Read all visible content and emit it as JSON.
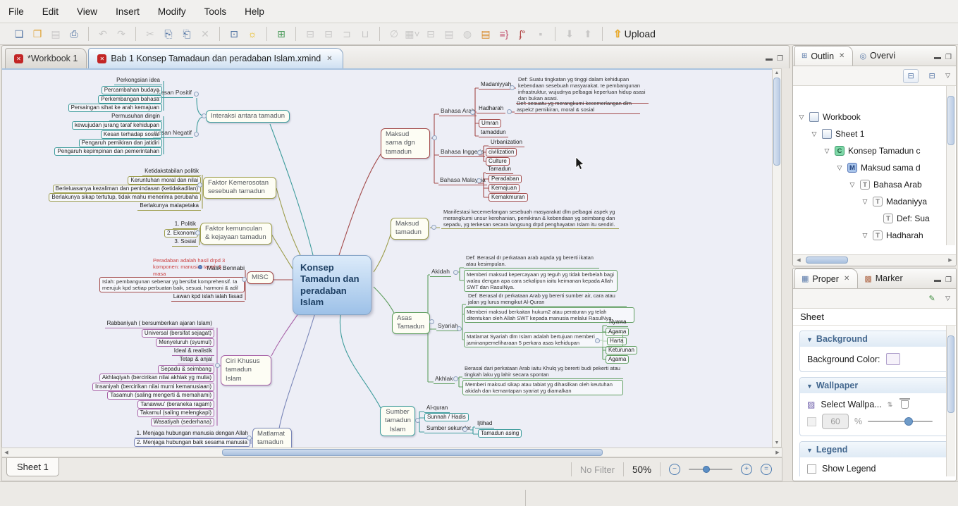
{
  "menu": {
    "items": [
      "File",
      "Edit",
      "View",
      "Insert",
      "Modify",
      "Tools",
      "Help"
    ]
  },
  "toolbar": {
    "upload_label": "Upload"
  },
  "editor_tabs": [
    {
      "label": "*Workbook 1"
    },
    {
      "label": "Bab 1 Konsep Tamadaun dan peradaban Islam.xmind"
    }
  ],
  "mindmap": {
    "colors": {
      "interaksi": "#3e9c9c",
      "faktor": "#9c9c4a",
      "misc": "#a34a4a",
      "ciri": "#a863a8",
      "matlamat": "#7a86b8",
      "sumber": "#3e9c9c",
      "asas": "#5f9e5f",
      "maksud": "#9c9c4a",
      "maksud_sama": "#a34a4a",
      "center_fill": "#aecdee"
    },
    "center": "Konsep Tamadun dan peradaban Islam",
    "maksud_sama": {
      "label": "Maksud sama dgn tamadun",
      "arab": {
        "label": "Bahasa Arab",
        "madaniyyah": "Madaniyyah",
        "madaniyyah_def": "Def: Suatu tingkatan yg tinggi dalam kehidupan kebendaan sesebuah masyarakat. Ie pembangunan infrastruktur, wujudnya pelbagai keperluan hidup asasi dan bukan asasi.",
        "hadharah": "Hadharah",
        "hadharah_def": "Def: sesuatu yg merangkumi kecemerlangan dlm aspek2 pemikiran, moral & sosial",
        "umran": "Umran",
        "tamaddun": "tamaddun"
      },
      "inggeris": {
        "label": "Bahasa Inggeris",
        "items": [
          "Urbanization",
          "civilization",
          "Culture"
        ]
      },
      "malaysia": {
        "label": "Bahasa Malaysia",
        "items": [
          "Tamadun",
          "Peradaban",
          "Kemajuan",
          "Kemakmuran"
        ]
      }
    },
    "maksud": {
      "label": "Maksud tamadun",
      "def": "Manifestasi kecemerlangan sesebuah masyarakat dlm pelbagai aspek yg merangkumi unsur kerohanian, pemikiran & kebendaan yg seimbang dan sepadu, yg terkesan secara langsung drpd penghayatan Islam itu sendiri."
    },
    "asas": {
      "label": "Asas Tamadun",
      "akidah": {
        "label": "Akidah",
        "def": "Def: Berasal dr perkataan arab aqada yg bererti ikatan atau kesimpulan.",
        "maksud": "Memberi maksud kepercayaan yg teguh yg tidak berbelah bagi walau dengan apa cara sekalipun iaitu keimanan kepada Allah SWT dan RasulNya."
      },
      "syariah": {
        "label": "Syariah",
        "def": "Def: Berasal dr perkataan Arab yg bererti sumber air, cara atau jalan yg lurus mengikut Al-Quran",
        "maksud": "Memberi maksud berkaitan hukum2 atau peraturan yg telah ditentukan oleh Allah SWT kepada manusia melalui RasulNya.",
        "matlamat": "Matlamat Syariah dlm Islam adalah bertujuan memberi jaminanpemeliharaan 5 perkara asas kehidupan",
        "perkara": [
          "Nyawa",
          "Agama",
          "Harta",
          "Keturunan",
          "Agama"
        ]
      },
      "akhlak": {
        "label": "Akhlak",
        "def": "Berasal dari perkataan Arab iaitu Khulq yg bererti budi pekerti atau tingkah laku yg lahir secara spontan",
        "maksud": "Memberi maksud sikap atau tabiat yg dihasilkan oleh keutuhan akidah dan kemantapan syariat yg diamalkan"
      }
    },
    "sumber": {
      "label": "Sumber tamadun Islam",
      "items": [
        "Al-quran",
        "Sunnah / Hadis",
        "Sumber sekunder"
      ],
      "sekunder": [
        "Ijtihad",
        "Tamadun asing"
      ]
    },
    "matlamat": {
      "label": "Matlamat tamadun",
      "items": [
        "1. Menjaga hubungan manusia dengan Allah",
        "2. Menjaga hubungan baik sesama manusia"
      ]
    },
    "ciri": {
      "label": "Ciri Khusus tamadun Islam",
      "items": [
        "Rabbaniyah ( bersumberkan ajaran Islam)",
        "Universal (bersifat sejagat)",
        "Menyeluruh (syumul)",
        "Ideal & realistik",
        "Tetap & anjal",
        "Sepadu & seimbang",
        "Akhlaqiyah (bercirikan nilai akhlak yg mulia)",
        "Insaniyah (bercirikan nilai murni kemanusiaan)",
        "Tasamuh (saling mengerti & memahami)",
        "Tanawwu' (beraneka ragam)",
        "Takamul (saling melengkapi)",
        "Wasatiyah (sederhana)"
      ]
    },
    "misc": {
      "label": "MISC",
      "note": "Peradaban adalah hasil drpd 3 komponen: manusia, tanah & masa",
      "bennabi": "Malik Bennabi",
      "islah": "Islah: pembangunan sebenar yg bersifat komprehensif. Ia merujuk kpd setiap perbuatan baik, sesuai, harmoni & adil",
      "lawan": "Lawan kpd islah ialah fasad"
    },
    "kemunculan": {
      "label": "Faktor kemunculan & kejayaan tamadun",
      "items": [
        "1. Politik",
        "2. Ekonomi",
        "3. Sosial"
      ]
    },
    "kemerosotan": {
      "label": "Faktor Kemerosotan sesebuah tamadun",
      "items": [
        "Ketidakstabilan politik",
        "Keruntuhan moral dan nilai",
        "Berleluasanya kezaliman dan penindasan (ketidakadilan)",
        "Berlakunya sikap tertutup, tidak mahu menerima perubaha",
        "Berlakunya malapetaka"
      ]
    },
    "interaksi": {
      "label": "Interaksi antara tamadun",
      "positif": {
        "label": "Kesan Positif",
        "items": [
          "Perkongsian idea",
          "Percambahan budaya",
          "Perkembangan bahasa",
          "Persaingan sihat ke arah kemajuan"
        ]
      },
      "negatif": {
        "label": "Kesan Negatif",
        "items": [
          "Permusuhan dingin",
          "kewujudan jurang taraf kehidupan",
          "Kesan terhadap sosial",
          "Pengaruh pemikiran dan jatidiri",
          "Pengaruh kepimpinan dan pemerintahan"
        ]
      }
    }
  },
  "outline": {
    "tab_outline": "Outlin",
    "tab_overview": "Overvi",
    "tree": [
      {
        "label": "Workbook"
      },
      {
        "label": "Sheet 1"
      },
      {
        "label": "Konsep Tamadun c"
      },
      {
        "label": "Maksud sama d"
      },
      {
        "label": "Bahasa Arab"
      },
      {
        "label": "Madaniyya"
      },
      {
        "label": "Def: Sua"
      },
      {
        "label": "Hadharah"
      }
    ]
  },
  "properties": {
    "tab_properties": "Proper",
    "tab_marker": "Marker",
    "sheet_label": "Sheet",
    "background": {
      "title": "Background",
      "color_label": "Background Color:"
    },
    "wallpaper": {
      "title": "Wallpaper",
      "select_label": "Select Wallpa...",
      "opacity_value": "60",
      "percent": "%"
    },
    "legend": {
      "title": "Legend",
      "show_label": "Show Legend"
    }
  },
  "statusbar": {
    "sheet_tab": "Sheet 1",
    "filter": "No Filter",
    "zoom": "50%"
  }
}
